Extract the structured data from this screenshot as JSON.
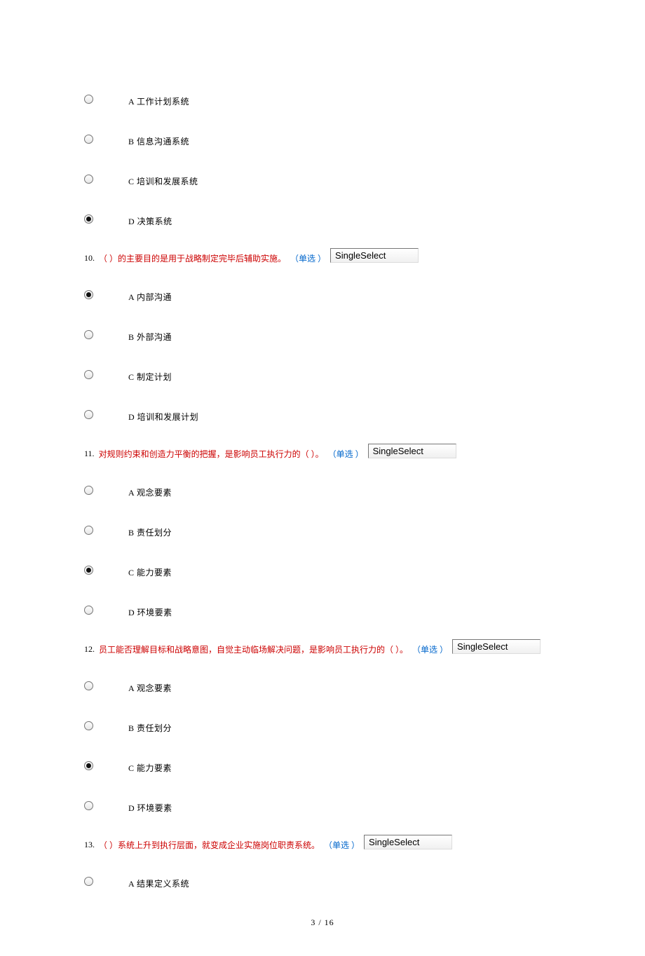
{
  "block0": {
    "options": [
      {
        "label": "A 工作计划系统",
        "selected": false
      },
      {
        "label": "B 信息沟通系统",
        "selected": false
      },
      {
        "label": "C 培训和发展系统",
        "selected": false
      },
      {
        "label": "D 决策系统",
        "selected": true
      }
    ]
  },
  "q10": {
    "num": "10.",
    "text": "（ ）的主要目的是用于战略制定完毕后辅助实施。",
    "type": "（单选 ）",
    "select": "SingleSelect",
    "options": [
      {
        "label": "A 内部沟通",
        "selected": true
      },
      {
        "label": "B 外部沟通",
        "selected": false
      },
      {
        "label": "C 制定计划",
        "selected": false
      },
      {
        "label": "D 培训和发展计划",
        "selected": false
      }
    ]
  },
  "q11": {
    "num": "11.",
    "text": "对规则约束和创造力平衡的把握，是影响员工执行力的（ ）。",
    "type": "（单选 ）",
    "select": "SingleSelect",
    "options": [
      {
        "label": "A 观念要素",
        "selected": false
      },
      {
        "label": "B 责任划分",
        "selected": false
      },
      {
        "label": "C 能力要素",
        "selected": true
      },
      {
        "label": "D 环境要素",
        "selected": false
      }
    ]
  },
  "q12": {
    "num": "12.",
    "text": "员工能否理解目标和战略意图，自觉主动临场解决问题，是影响员工执行力的（ ）。",
    "type": "（单选 ）",
    "select": "SingleSelect",
    "options": [
      {
        "label": "A 观念要素",
        "selected": false
      },
      {
        "label": "B 责任划分",
        "selected": false
      },
      {
        "label": "C 能力要素",
        "selected": true
      },
      {
        "label": "D 环境要素",
        "selected": false
      }
    ]
  },
  "q13": {
    "num": "13.",
    "text": "（ ）系统上升到执行层面，就变成企业实施岗位职责系统。",
    "type": "（单选 ）",
    "select": "SingleSelect",
    "options": [
      {
        "label": "A 结果定义系统",
        "selected": false
      }
    ]
  },
  "footer": "3  /  16"
}
